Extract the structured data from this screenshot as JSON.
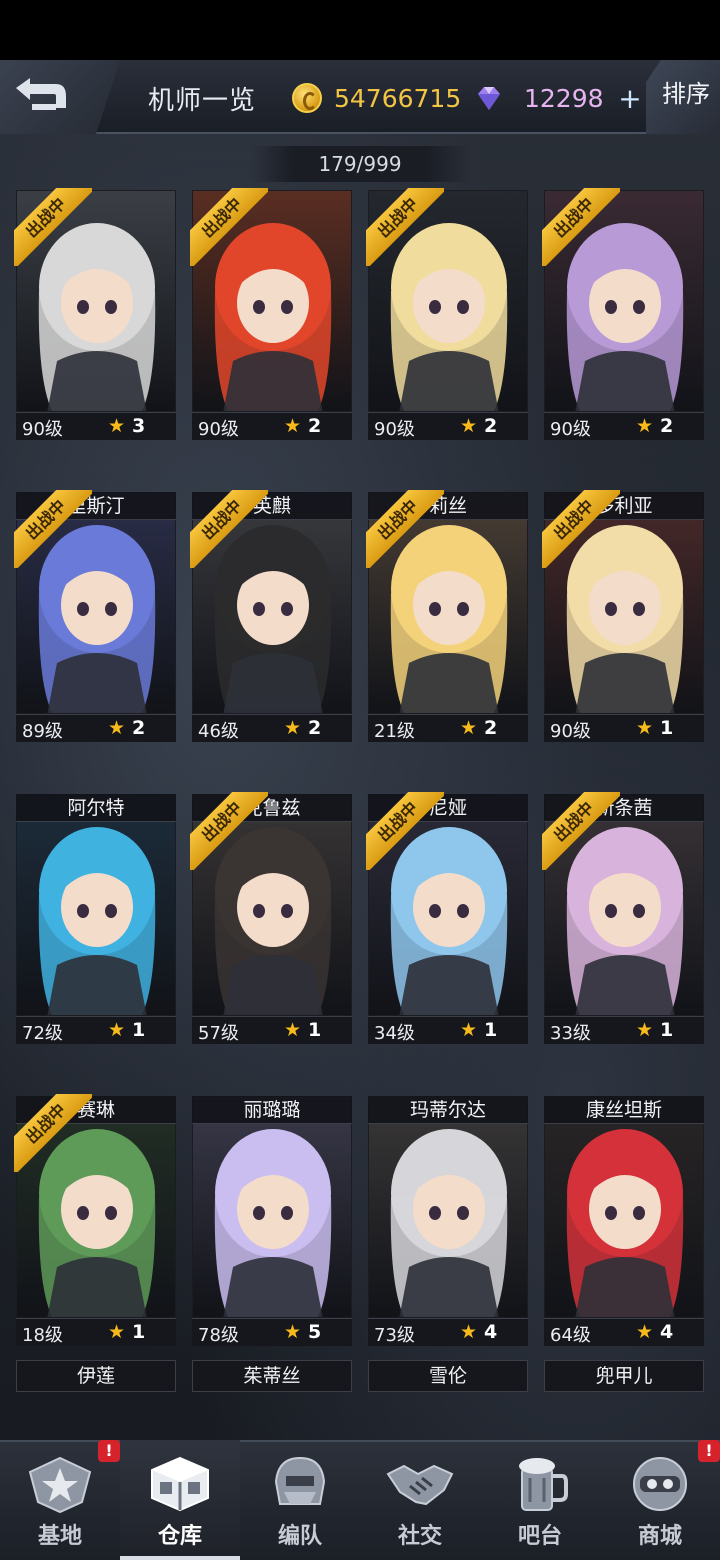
{
  "header": {
    "title": "机师一览",
    "gold": "54766715",
    "gems": "12298",
    "plus_label": "+",
    "sort_label": "排序"
  },
  "roster_count": "179/999",
  "deploy_label": "出战中",
  "cards": [
    {
      "level": "90级",
      "stars": "3",
      "name": "",
      "deployed": true,
      "art": "#3b3f45",
      "hair": "#d8d8d8"
    },
    {
      "level": "90级",
      "stars": "2",
      "name": "",
      "deployed": true,
      "art": "#5a2e22",
      "hair": "#e2462a"
    },
    {
      "level": "90级",
      "stars": "2",
      "name": "",
      "deployed": true,
      "art": "#24282e",
      "hair": "#f0dc9c"
    },
    {
      "level": "90级",
      "stars": "2",
      "name": "",
      "deployed": true,
      "art": "#3a2a33",
      "hair": "#b79ad6"
    },
    {
      "level": "89级",
      "stars": "2",
      "name": "里斯汀",
      "deployed": true,
      "art": "#2b2f4a",
      "hair": "#6a7ad8"
    },
    {
      "level": "46级",
      "stars": "2",
      "name": "英麒",
      "deployed": true,
      "art": "#3a3c40",
      "hair": "#2b2b2d"
    },
    {
      "level": "21级",
      "stars": "2",
      "name": "莉丝",
      "deployed": true,
      "art": "#4a3f35",
      "hair": "#f3d27a"
    },
    {
      "level": "90级",
      "stars": "1",
      "name": "多利亚",
      "deployed": true,
      "art": "#4a2a2a",
      "hair": "#f2dca8"
    },
    {
      "level": "72级",
      "stars": "1",
      "name": "阿尔特",
      "deployed": false,
      "art": "#1d2d3c",
      "hair": "#3fb2e0"
    },
    {
      "level": "57级",
      "stars": "1",
      "name": "克鲁兹",
      "deployed": true,
      "art": "#3a3636",
      "hair": "#3a3432"
    },
    {
      "level": "34级",
      "stars": "1",
      "name": "尼娅",
      "deployed": true,
      "art": "#2c2c3a",
      "hair": "#8ec6ec"
    },
    {
      "level": "33级",
      "stars": "1",
      "name": "新条茜",
      "deployed": true,
      "art": "#3a3438",
      "hair": "#d8b4dc"
    },
    {
      "level": "18级",
      "stars": "1",
      "name": "赛琳",
      "deployed": true,
      "art": "#233026",
      "hair": "#5e9a58"
    },
    {
      "level": "78级",
      "stars": "5",
      "name": "丽璐璐",
      "deployed": false,
      "art": "#3a3a4a",
      "hair": "#cabdf0"
    },
    {
      "level": "73级",
      "stars": "4",
      "name": "玛蒂尔达",
      "deployed": false,
      "art": "#3a3838",
      "hair": "#d6d6da"
    },
    {
      "level": "64级",
      "stars": "4",
      "name": "康丝坦斯",
      "deployed": false,
      "art": "#2a2626",
      "hair": "#d4313a"
    }
  ],
  "next_names": [
    "伊莲",
    "茱蒂丝",
    "雪伦",
    "兜甲儿"
  ],
  "nav": [
    {
      "label": "基地",
      "icon": "base-star-icon",
      "badge": "!"
    },
    {
      "label": "仓库",
      "icon": "warehouse-cube-icon",
      "badge": ""
    },
    {
      "label": "编队",
      "icon": "mech-helmet-icon",
      "badge": ""
    },
    {
      "label": "社交",
      "icon": "handshake-icon",
      "badge": ""
    },
    {
      "label": "吧台",
      "icon": "beer-mug-icon",
      "badge": ""
    },
    {
      "label": "商城",
      "icon": "shop-robot-icon",
      "badge": "!"
    }
  ],
  "colors": {
    "gold": "#f3c544",
    "gem": "#e6b4ee",
    "star": "#f7b91b",
    "ribbon": "#f0b82c"
  }
}
